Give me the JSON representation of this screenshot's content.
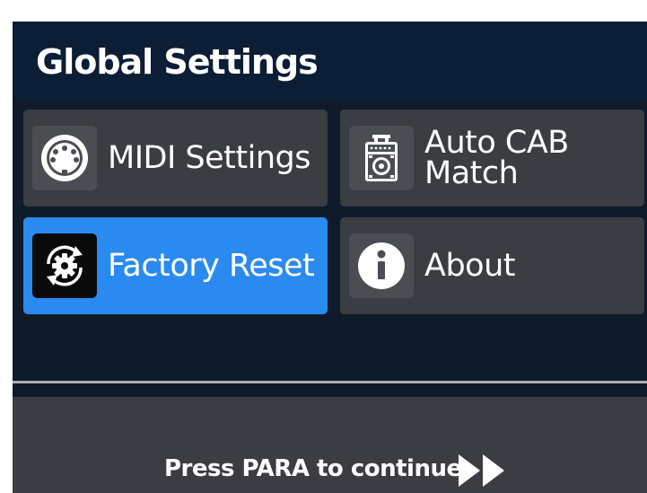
{
  "header": {
    "title": "Global Settings"
  },
  "menu": {
    "items": [
      {
        "label": "MIDI Settings",
        "icon": "midi-din-icon",
        "selected": false
      },
      {
        "label": "Auto CAB\nMatch",
        "icon": "speaker-cabinet-icon",
        "selected": false
      },
      {
        "label": "Factory Reset",
        "icon": "factory-reset-gear-icon",
        "selected": true
      },
      {
        "label": "About",
        "icon": "info-icon",
        "selected": false
      }
    ]
  },
  "footer": {
    "hint": "Press PARA to continue",
    "icon": "fast-forward-icon"
  },
  "colors": {
    "background": "#0f1a2a",
    "header": "#0c1e36",
    "tile": "#3a3d41",
    "tile_selected": "#2a8af0",
    "footer": "#3b3d42"
  }
}
